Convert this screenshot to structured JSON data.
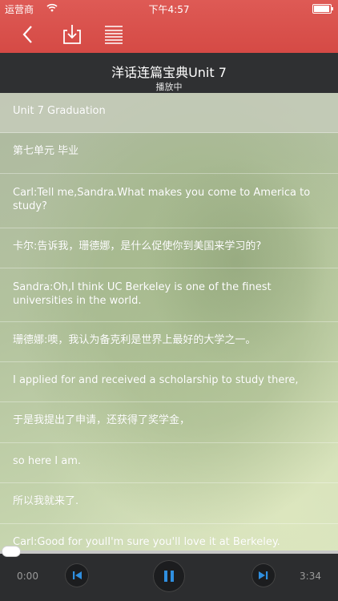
{
  "status": {
    "carrier": "运营商",
    "time": "下午4:57"
  },
  "header": {
    "title": "洋话连篇宝典Unit 7",
    "subtitle": "播放中"
  },
  "lines": [
    "Unit 7   Graduation",
    "第七单元   毕业",
    "Carl:Tell me,Sandra.What makes you come to America to study?",
    "卡尔:告诉我，珊德娜，是什么促使你到美国来学习的?",
    "Sandra:Oh,I think UC Berkeley is one of the finest universities in the world.",
    "珊德娜:噢，我认为备克利是世界上最好的大学之一。",
    "I applied for and received a scholarship to study there,",
    "于是我提出了申请，还获得了奖学金，",
    "so here I am.",
    "所以我就来了.",
    "Carl:Good for youlI'm sure you'll love it at Berkeley."
  ],
  "player": {
    "current_time": "0:00",
    "total_time": "3:34",
    "progress": 0.0,
    "accent": "#2f8fe0"
  },
  "colors": {
    "toolbar": "#d9534f",
    "titlebar": "#2f3032",
    "playerbar": "#2c2d2f"
  },
  "icons": [
    "back-icon",
    "download-icon",
    "list-icon",
    "wifi-icon",
    "battery-icon",
    "previous-icon",
    "pause-icon",
    "next-icon"
  ]
}
